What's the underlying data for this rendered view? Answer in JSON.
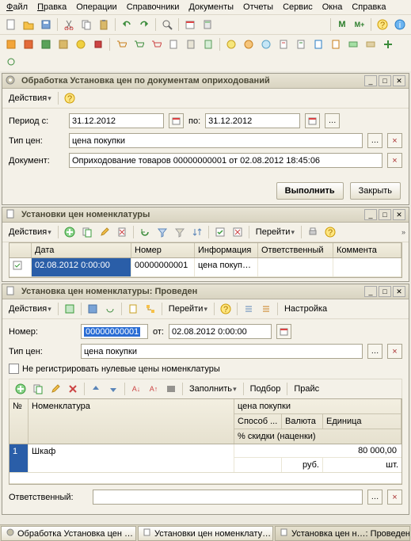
{
  "menu": {
    "file": "Файл",
    "edit": "Правка",
    "ops": "Операции",
    "refs": "Справочники",
    "docs": "Документы",
    "reports": "Отчеты",
    "service": "Сервис",
    "windows": "Окна",
    "help": "Справка"
  },
  "win1": {
    "title": "Обработка  Установка цен по документам оприходований",
    "actions": "Действия",
    "period_label": "Период с:",
    "period_from": "31.12.2012",
    "period_to_label": "по:",
    "period_to": "31.12.2012",
    "type_label": "Тип цен:",
    "type_value": "цена покупки",
    "doc_label": "Документ:",
    "doc_value": "Оприходование товаров 00000000001 от 02.08.2012 18:45:06",
    "execute": "Выполнить",
    "close": "Закрыть"
  },
  "win2": {
    "title": "Установки цен номенклатуры",
    "actions": "Действия",
    "goto": "Перейти",
    "cols": {
      "c0": "",
      "c1": "Дата",
      "c2": "Номер",
      "c3": "Информация",
      "c4": "Ответственный",
      "c5": "Коммента"
    },
    "row": {
      "date": "02.08.2012 0:00:00",
      "num": "00000000001",
      "info": "цена покуп…",
      "resp": "",
      "comment": ""
    }
  },
  "win3": {
    "title": "Установка цен номенклатуры: Проведен",
    "actions": "Действия",
    "goto": "Перейти",
    "settings": "Настройка",
    "num_label": "Номер:",
    "num_value": "00000000001",
    "date_label": "от:",
    "date_value": "02.08.2012  0:00:00",
    "type_label": "Тип цен:",
    "type_value": "цена покупки",
    "chk_label": "Не регистрировать нулевые цены номенклатуры",
    "fill": "Заполнить",
    "select": "Подбор",
    "price": "Прайс",
    "cols": {
      "n": "№",
      "nom": "Номенклатура",
      "price": "цена покупки",
      "method": "Способ ...",
      "currency": "Валюта",
      "unit": "Единица",
      "discount": "% скидки (наценки)"
    },
    "row": {
      "n": "1",
      "name": "Шкаф",
      "price": "80 000,00",
      "currency": "руб.",
      "unit": "шт."
    },
    "resp_label": "Ответственный:"
  },
  "taskbar": {
    "t1": "Обработка  Установка цен …",
    "t2": "Установки цен номенклату…",
    "t3": "Установка цен н…: Проведен"
  }
}
